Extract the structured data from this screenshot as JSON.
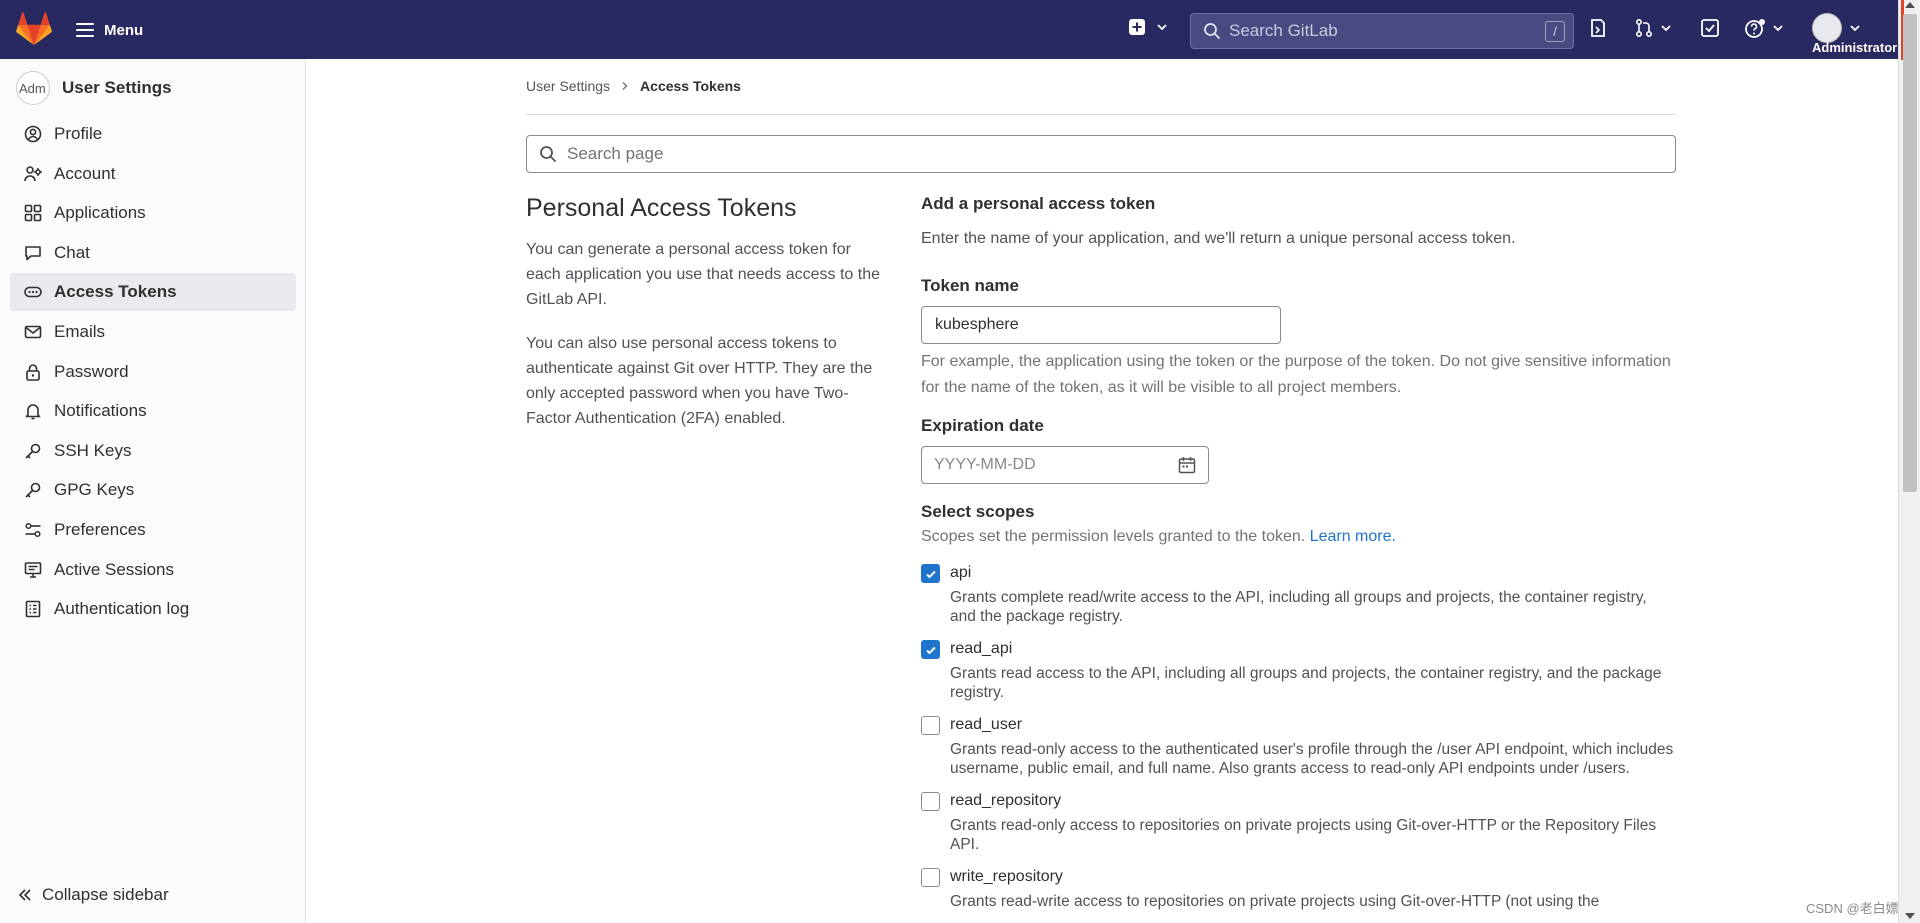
{
  "topbar": {
    "menu_label": "Menu",
    "search_placeholder": "Search GitLab",
    "search_shortcut": "/",
    "user_label": "Administrator"
  },
  "sidebar": {
    "avatar_alt": "Adm",
    "title": "User Settings",
    "items": [
      {
        "label": "Profile",
        "icon": "profile-icon",
        "active": false
      },
      {
        "label": "Account",
        "icon": "account-icon",
        "active": false
      },
      {
        "label": "Applications",
        "icon": "applications-icon",
        "active": false
      },
      {
        "label": "Chat",
        "icon": "chat-icon",
        "active": false
      },
      {
        "label": "Access Tokens",
        "icon": "token-icon",
        "active": true
      },
      {
        "label": "Emails",
        "icon": "mail-icon",
        "active": false
      },
      {
        "label": "Password",
        "icon": "lock-icon",
        "active": false
      },
      {
        "label": "Notifications",
        "icon": "bell-icon",
        "active": false
      },
      {
        "label": "SSH Keys",
        "icon": "key-icon",
        "active": false
      },
      {
        "label": "GPG Keys",
        "icon": "key-icon",
        "active": false
      },
      {
        "label": "Preferences",
        "icon": "preferences-icon",
        "active": false
      },
      {
        "label": "Active Sessions",
        "icon": "monitor-icon",
        "active": false
      },
      {
        "label": "Authentication log",
        "icon": "log-icon",
        "active": false
      }
    ],
    "collapse_label": "Collapse sidebar"
  },
  "breadcrumb": {
    "parent": "User Settings",
    "current": "Access Tokens"
  },
  "page_search_placeholder": "Search page",
  "intro": {
    "title": "Personal Access Tokens",
    "para1": "You can generate a personal access token for each application you use that needs access to the GitLab API.",
    "para2": "You can also use personal access tokens to authenticate against Git over HTTP. They are the only accepted password when you have Two-Factor Authentication (2FA) enabled."
  },
  "form": {
    "section_title": "Add a personal access token",
    "section_desc": "Enter the name of your application, and we'll return a unique personal access token.",
    "token_name_label": "Token name",
    "token_name_value": "kubesphere",
    "token_help": "For example, the application using the token or the purpose of the token. Do not give sensitive information for the name of the token, as it will be visible to all project members.",
    "expiration_label": "Expiration date",
    "expiration_placeholder": "YYYY-MM-DD",
    "scopes_label": "Select scopes",
    "scopes_desc": "Scopes set the permission levels granted to the token.",
    "learn_more": "Learn more.",
    "scopes": [
      {
        "name": "api",
        "checked": true,
        "desc": "Grants complete read/write access to the API, including all groups and projects, the container registry, and the package registry."
      },
      {
        "name": "read_api",
        "checked": true,
        "desc": "Grants read access to the API, including all groups and projects, the container registry, and the package registry."
      },
      {
        "name": "read_user",
        "checked": false,
        "desc": "Grants read-only access to the authenticated user's profile through the /user API endpoint, which includes username, public email, and full name. Also grants access to read-only API endpoints under /users."
      },
      {
        "name": "read_repository",
        "checked": false,
        "desc": "Grants read-only access to repositories on private projects using Git-over-HTTP or the Repository Files API."
      },
      {
        "name": "write_repository",
        "checked": false,
        "desc": "Grants read-write access to repositories on private projects using Git-over-HTTP (not using the"
      }
    ]
  },
  "watermark": "CSDN @老白嫖",
  "colors": {
    "topbar": "#292961",
    "accent": "#1f75cb",
    "sidebar_bg": "#fbfafd"
  }
}
